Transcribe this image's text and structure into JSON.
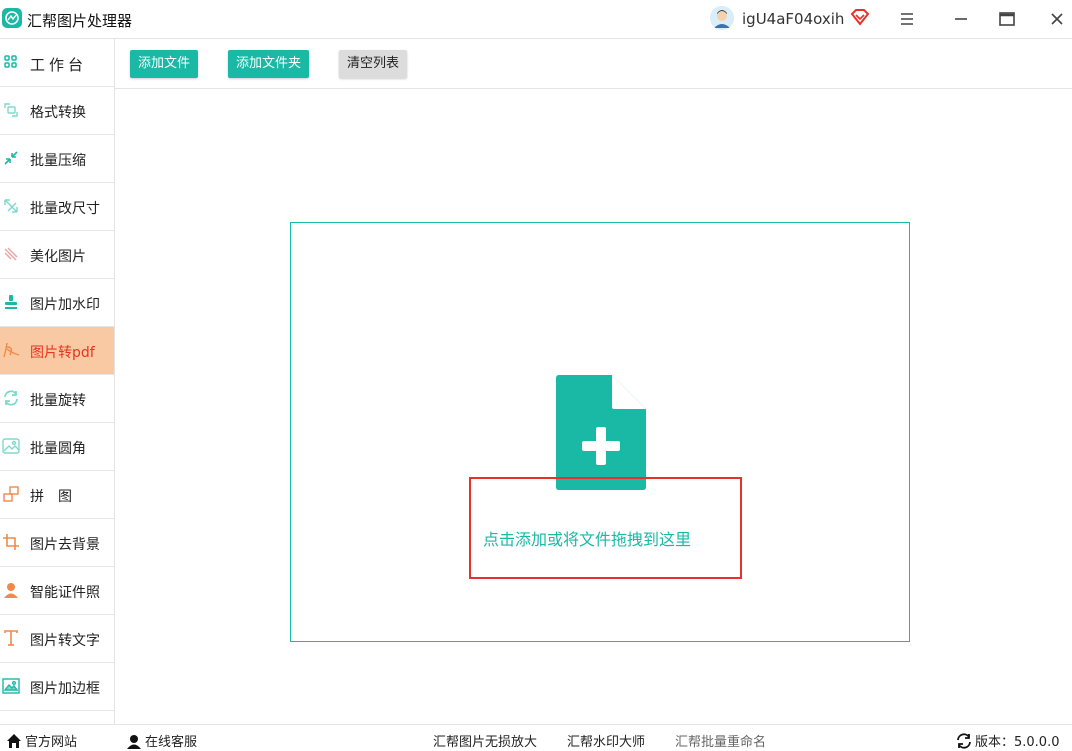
{
  "titlebar": {
    "app_title": "汇帮图片处理器",
    "username": "igU4aF04oxih",
    "icons": [
      "app-logo-icon",
      "avatar",
      "vip-diamond-icon",
      "menu-icon",
      "minimize-icon",
      "maximize-icon",
      "close-icon"
    ]
  },
  "sidebar": {
    "items": [
      {
        "label": "工作台",
        "icon": "grid-icon"
      },
      {
        "label": "格式转换",
        "icon": "convert-icon"
      },
      {
        "label": "批量压缩",
        "icon": "compress-icon"
      },
      {
        "label": "批量改尺寸",
        "icon": "resize-icon"
      },
      {
        "label": "美化图片",
        "icon": "beautify-icon"
      },
      {
        "label": "图片加水印",
        "icon": "watermark-icon"
      },
      {
        "label": "图片转pdf",
        "icon": "pdf-icon"
      },
      {
        "label": "批量旋转",
        "icon": "rotate-icon"
      },
      {
        "label": "批量圆角",
        "icon": "rounded-corner-icon"
      },
      {
        "label": "拼　图",
        "icon": "collage-icon"
      },
      {
        "label": "图片去背景",
        "icon": "crop-icon"
      },
      {
        "label": "智能证件照",
        "icon": "person-icon"
      },
      {
        "label": "图片转文字",
        "icon": "text-icon"
      },
      {
        "label": "图片加边框",
        "icon": "frame-icon"
      }
    ],
    "active_index": 6
  },
  "toolbar": {
    "add_file": "添加文件",
    "add_folder": "添加文件夹",
    "clear_list": "清空列表"
  },
  "dropzone": {
    "prompt": "点击添加或将文件拖拽到这里"
  },
  "footer": {
    "official_site": "官方网站",
    "online_service": "在线客服",
    "link1": "汇帮图片无损放大",
    "link2": "汇帮水印大师",
    "link3": "汇帮批量重命名",
    "version": "版本：5.0.0.0"
  },
  "colors": {
    "accent": "#19b9a6",
    "active_bg": "#f9c9a4",
    "active_text": "#e8351f",
    "highlight_border": "#e8312a"
  }
}
